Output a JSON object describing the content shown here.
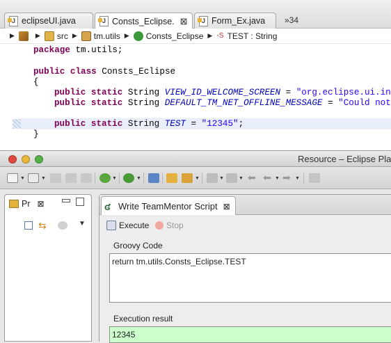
{
  "editor": {
    "tabs": [
      {
        "label": "eclipseUI.java",
        "active": false
      },
      {
        "label": "Consts_Eclipse.",
        "active": true
      },
      {
        "label": "Form_Ex.java",
        "active": false
      }
    ],
    "overflow_label": "»34",
    "breadcrumb": [
      "src",
      "tm.utils",
      "Consts_Eclipse",
      "TEST : String"
    ],
    "code": {
      "line1_kw": "package",
      "line1_rest": " tm.utils;",
      "line2_kw1": "public",
      "line2_kw2": "class",
      "line2_rest": " Consts_Eclipse",
      "line3": "{",
      "line4_kw1": "public",
      "line4_kw2": "static",
      "line4_type": " String ",
      "line4_field": "VIEW_ID_WELCOME_SCREEN",
      "line4_eq": " = ",
      "line4_str": "\"org.eclipse.ui.inte",
      "line5_kw1": "public",
      "line5_kw2": "static",
      "line5_type": " String ",
      "line5_field": "DEFAULT_TM_NET_OFFLINE_MESSAGE",
      "line5_eq": " = ",
      "line5_str": "\"Could not c",
      "line6_kw1": "public",
      "line6_kw2": "static",
      "line6_type": " String ",
      "line6_field": "TEST",
      "line6_eq": " = ",
      "line6_str": "\"12345\"",
      "line6_end": ";",
      "line7": "}"
    }
  },
  "window": {
    "title": "Resource – Eclipse Pla"
  },
  "package_explorer": {
    "tab_label": "Pr"
  },
  "script_view": {
    "tab_label": "Write TeamMentor Script",
    "execute_label": "Execute",
    "stop_label": "Stop",
    "groovy_label": "Groovy Code",
    "groovy_code": "return tm.utils.Consts_Eclipse.TEST",
    "result_label": "Execution result",
    "result_value": "12345"
  },
  "colors": {
    "keyword": "#7f0055",
    "string": "#2a00ff",
    "field": "#0000c0",
    "result_bg": "#ccffcc"
  }
}
